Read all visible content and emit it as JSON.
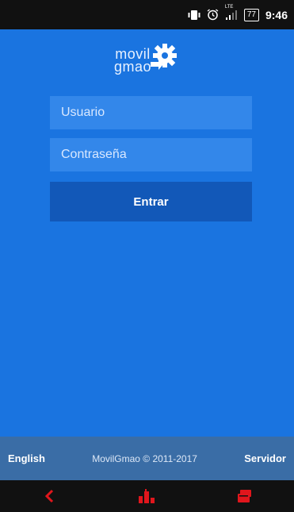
{
  "status_bar": {
    "network_label": "LTE",
    "battery": "77",
    "time": "9:46"
  },
  "logo": {
    "line1": "movil",
    "line2": "gmao"
  },
  "login": {
    "username_placeholder": "Usuario",
    "password_placeholder": "Contraseña",
    "submit_label": "Entrar"
  },
  "footer": {
    "language_link": "English",
    "copyright": "MovilGmao © 2011-2017",
    "server_link": "Servidor"
  },
  "colors": {
    "background": "#1a74e0",
    "field": "#3387ea",
    "button": "#1258b8",
    "footer": "#3a6da6",
    "nav_icons": "#e0161c"
  },
  "icons": {
    "status": [
      "vibrate-icon",
      "alarm-icon",
      "signal-icon",
      "battery-icon"
    ],
    "navigation": [
      "back-icon",
      "home-icon",
      "recent-apps-icon"
    ]
  }
}
